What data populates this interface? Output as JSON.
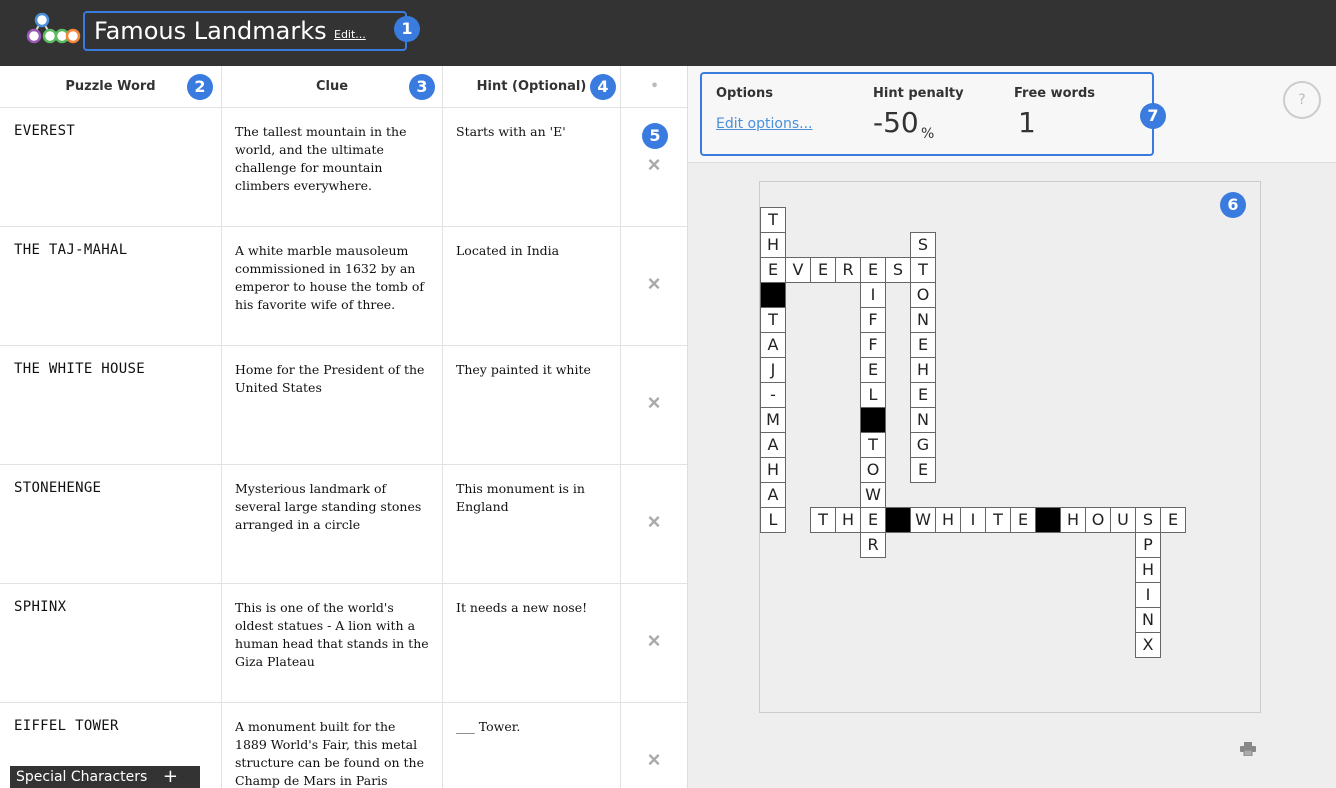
{
  "header": {
    "title": "Famous Landmarks",
    "edit_label": "Edit...",
    "logo_icon": "app-logo-icon",
    "bg_color": "#333333",
    "accent": "#3a7be0"
  },
  "badges": [
    "1",
    "2",
    "3",
    "4",
    "5",
    "6",
    "7"
  ],
  "table": {
    "headers": {
      "word": "Puzzle Word",
      "clue": "Clue",
      "hint": "Hint (Optional)",
      "actions": "•"
    },
    "rows": [
      {
        "word": "EVEREST",
        "clue": "The tallest mountain in the world, and the ultimate challenge for mountain climbers everywhere.",
        "hint": "Starts with an 'E'"
      },
      {
        "word": "THE TAJ-MAHAL",
        "clue": "A white marble mausoleum commissioned in 1632 by an emperor to house the tomb of his favorite wife of three.",
        "hint": "Located in India"
      },
      {
        "word": "THE WHITE HOUSE",
        "clue": "Home for the President of the United States",
        "hint": "They painted it white"
      },
      {
        "word": "STONEHENGE",
        "clue": "Mysterious landmark of several large standing stones arranged in a circle",
        "hint": "This monument is in England"
      },
      {
        "word": "SPHINX",
        "clue": "This is one of the world's oldest statues - A lion with a human head that stands in the Giza Plateau",
        "hint": "It needs a new nose!"
      },
      {
        "word": "EIFFEL TOWER",
        "clue": "A monument built for the 1889 World's Fair, this metal structure can be found on the Champ de Mars in Paris",
        "hint": "___ Tower."
      }
    ],
    "delete_icon": "×"
  },
  "special_characters": {
    "label": "Special Characters",
    "toggle": "+"
  },
  "options": {
    "title": "Options",
    "edit_label": "Edit options...",
    "hint_penalty_label": "Hint penalty",
    "hint_penalty_value": "-50",
    "hint_penalty_unit": "%",
    "free_words_label": "Free words",
    "free_words_value": "1"
  },
  "help_label": "?",
  "print_icon": "printer-icon",
  "crossword": {
    "cells": [
      {
        "c": 0,
        "r": 0,
        "ch": "T"
      },
      {
        "c": 0,
        "r": 1,
        "ch": "H"
      },
      {
        "c": 0,
        "r": 2,
        "ch": "E"
      },
      {
        "c": 0,
        "r": 3,
        "ch": ""
      },
      {
        "c": 0,
        "r": 4,
        "ch": "T"
      },
      {
        "c": 0,
        "r": 5,
        "ch": "A"
      },
      {
        "c": 0,
        "r": 6,
        "ch": "J"
      },
      {
        "c": 0,
        "r": 7,
        "ch": "-"
      },
      {
        "c": 0,
        "r": 8,
        "ch": "M"
      },
      {
        "c": 0,
        "r": 9,
        "ch": "A"
      },
      {
        "c": 0,
        "r": 10,
        "ch": "H"
      },
      {
        "c": 0,
        "r": 11,
        "ch": "A"
      },
      {
        "c": 0,
        "r": 12,
        "ch": "L"
      },
      {
        "c": 1,
        "r": 2,
        "ch": "V"
      },
      {
        "c": 2,
        "r": 2,
        "ch": "E"
      },
      {
        "c": 3,
        "r": 2,
        "ch": "R"
      },
      {
        "c": 4,
        "r": 2,
        "ch": "E"
      },
      {
        "c": 5,
        "r": 2,
        "ch": "S"
      },
      {
        "c": 6,
        "r": 1,
        "ch": "S"
      },
      {
        "c": 6,
        "r": 2,
        "ch": "T"
      },
      {
        "c": 6,
        "r": 3,
        "ch": "O"
      },
      {
        "c": 6,
        "r": 4,
        "ch": "N"
      },
      {
        "c": 6,
        "r": 5,
        "ch": "E"
      },
      {
        "c": 6,
        "r": 6,
        "ch": "H"
      },
      {
        "c": 6,
        "r": 7,
        "ch": "E"
      },
      {
        "c": 6,
        "r": 8,
        "ch": "N"
      },
      {
        "c": 6,
        "r": 9,
        "ch": "G"
      },
      {
        "c": 6,
        "r": 10,
        "ch": "E"
      },
      {
        "c": 4,
        "r": 3,
        "ch": "I"
      },
      {
        "c": 4,
        "r": 4,
        "ch": "F"
      },
      {
        "c": 4,
        "r": 5,
        "ch": "F"
      },
      {
        "c": 4,
        "r": 6,
        "ch": "E"
      },
      {
        "c": 4,
        "r": 7,
        "ch": "L"
      },
      {
        "c": 4,
        "r": 8,
        "ch": ""
      },
      {
        "c": 4,
        "r": 9,
        "ch": "T"
      },
      {
        "c": 4,
        "r": 10,
        "ch": "O"
      },
      {
        "c": 4,
        "r": 11,
        "ch": "W"
      },
      {
        "c": 4,
        "r": 12,
        "ch": "E"
      },
      {
        "c": 4,
        "r": 13,
        "ch": "R"
      },
      {
        "c": 2,
        "r": 12,
        "ch": "T"
      },
      {
        "c": 3,
        "r": 12,
        "ch": "H"
      },
      {
        "c": 5,
        "r": 12,
        "ch": ""
      },
      {
        "c": 6,
        "r": 12,
        "ch": "W"
      },
      {
        "c": 7,
        "r": 12,
        "ch": "H"
      },
      {
        "c": 8,
        "r": 12,
        "ch": "I"
      },
      {
        "c": 9,
        "r": 12,
        "ch": "T"
      },
      {
        "c": 10,
        "r": 12,
        "ch": "E"
      },
      {
        "c": 11,
        "r": 12,
        "ch": ""
      },
      {
        "c": 12,
        "r": 12,
        "ch": "H"
      },
      {
        "c": 13,
        "r": 12,
        "ch": "O"
      },
      {
        "c": 14,
        "r": 12,
        "ch": "U"
      },
      {
        "c": 15,
        "r": 12,
        "ch": "S"
      },
      {
        "c": 16,
        "r": 12,
        "ch": "E"
      },
      {
        "c": 15,
        "r": 13,
        "ch": "P"
      },
      {
        "c": 15,
        "r": 14,
        "ch": "H"
      },
      {
        "c": 15,
        "r": 15,
        "ch": "I"
      },
      {
        "c": 15,
        "r": 16,
        "ch": "N"
      },
      {
        "c": 15,
        "r": 17,
        "ch": "X"
      }
    ]
  }
}
